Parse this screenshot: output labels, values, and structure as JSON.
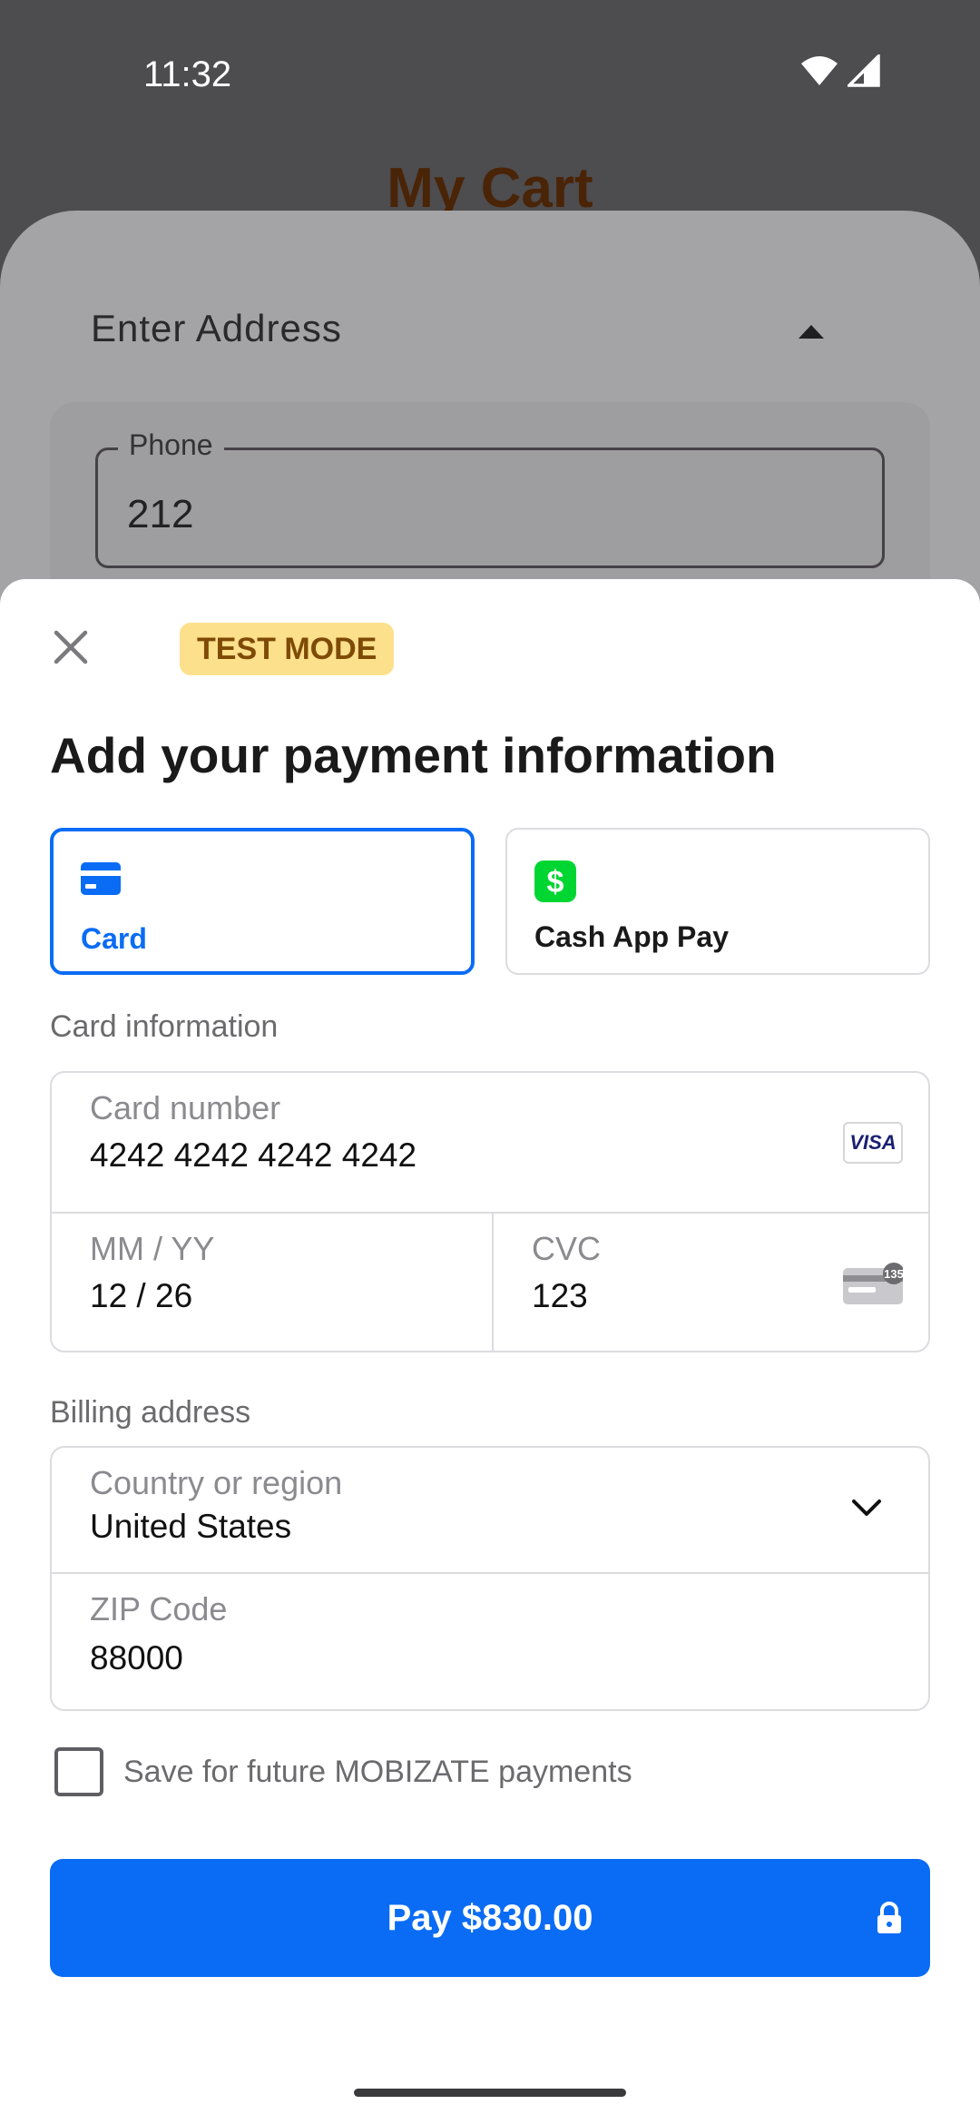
{
  "status_bar": {
    "time": "11:32"
  },
  "background": {
    "title": "My Cart",
    "address_label": "Enter Address",
    "phone": {
      "label": "Phone",
      "value": "212"
    }
  },
  "sheet": {
    "badge": "TEST MODE",
    "title": "Add your payment information",
    "payment_methods": [
      {
        "label": "Card",
        "icon": "credit-card-icon",
        "selected": true
      },
      {
        "label": "Cash App Pay",
        "icon": "cash-app-icon",
        "selected": false
      }
    ],
    "card_section_label": "Card information",
    "card_number": {
      "label": "Card number",
      "value": "4242 4242 4242 4242",
      "brand": "VISA"
    },
    "expiry": {
      "label": "MM / YY",
      "value": "12 / 26"
    },
    "cvc": {
      "label": "CVC",
      "value": "123",
      "hint": "135"
    },
    "billing_section_label": "Billing address",
    "country": {
      "label": "Country or region",
      "value": "United States"
    },
    "zip": {
      "label": "ZIP Code",
      "value": "88000"
    },
    "save_label": "Save for future MOBIZATE payments",
    "pay_label": "Pay $830.00"
  },
  "colors": {
    "accent": "#0a6cf5",
    "badge_bg": "#fde08c",
    "badge_text": "#7e4a05",
    "cash_app_green": "#00d632"
  }
}
